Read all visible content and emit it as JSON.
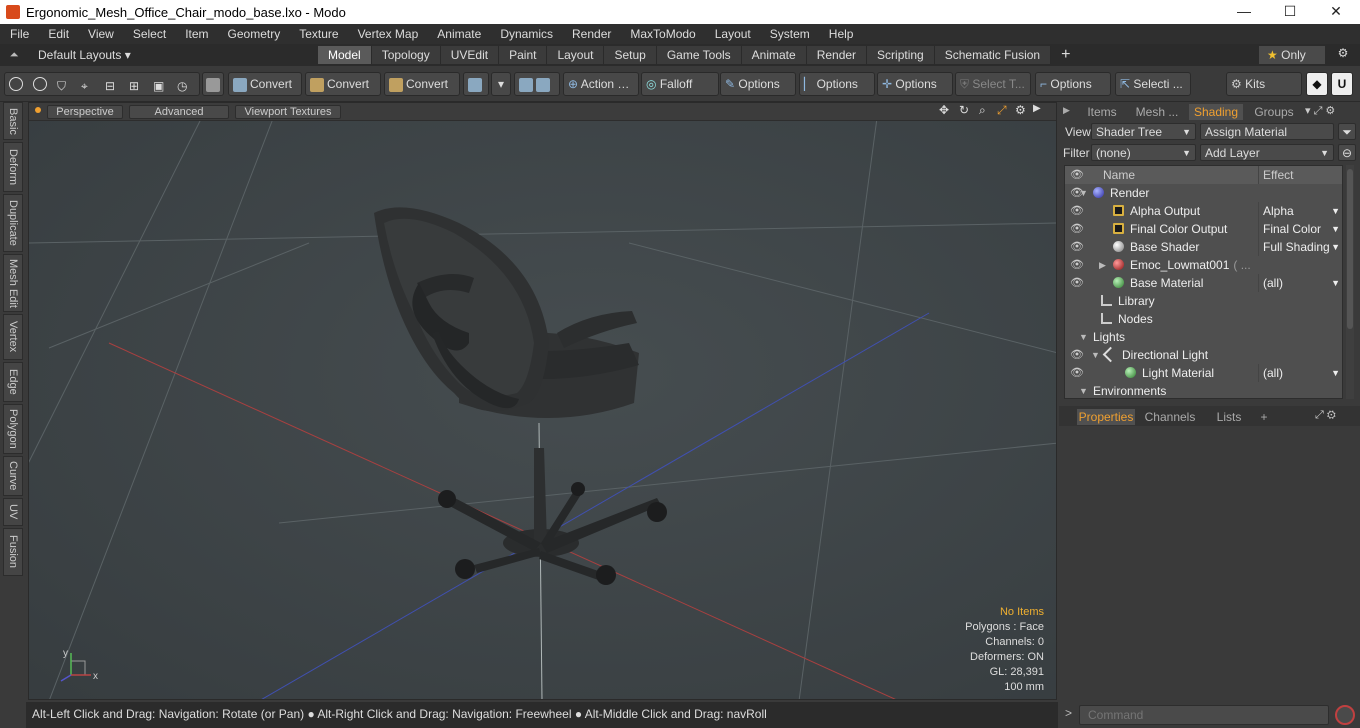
{
  "window": {
    "title": "Ergonomic_Mesh_Office_Chair_modo_base.lxo - Modo",
    "minimize": "—",
    "maximize": "☐",
    "close": "✕"
  },
  "menu": [
    "File",
    "Edit",
    "View",
    "Select",
    "Item",
    "Geometry",
    "Texture",
    "Vertex Map",
    "Animate",
    "Dynamics",
    "Render",
    "MaxToModo",
    "Layout",
    "System",
    "Help"
  ],
  "layoutbar": {
    "default_layouts": "Default Layouts ▾",
    "tabs": [
      "Model",
      "Topology",
      "UVEdit",
      "Paint",
      "Layout",
      "Setup",
      "Game Tools",
      "Animate",
      "Render",
      "Scripting",
      "Schematic Fusion"
    ],
    "active_tab": "Model",
    "add": "+",
    "only": "Only"
  },
  "toolbar": {
    "convert1": "Convert",
    "convert2": "Convert",
    "convert3": "Convert",
    "action": "Action",
    "falloff": "Falloff",
    "options1": "Options",
    "options2": "Options",
    "options3": "Options",
    "options4": "Options",
    "select_t": "Select T...",
    "selecti": "Selecti ...",
    "kits": "Kits"
  },
  "lefttabs": [
    "Basic",
    "Deform",
    "Duplicate",
    "Mesh Edit",
    "Vertex",
    "Edge",
    "Polygon",
    "Curve",
    "UV",
    "Fusion"
  ],
  "viewport": {
    "perspective": "Perspective",
    "advanced": "Advanced",
    "textures": "Viewport Textures",
    "hud": {
      "no_items": "No Items",
      "polygons": "Polygons : Face",
      "channels": "Channels: 0",
      "deformers": "Deformers: ON",
      "gl": "GL: 28,391",
      "scale": "100 mm"
    },
    "axes": {
      "x": "x",
      "y": "y"
    }
  },
  "status": "Alt-Left Click and Drag: Navigation: Rotate (or Pan) ● Alt-Right Click and Drag: Navigation: Freewheel ● Alt-Middle Click and Drag: navRoll",
  "shader": {
    "tabs": [
      "Items",
      "Mesh ...",
      "Shading",
      "Groups"
    ],
    "active_tab": "Shading",
    "view_label": "View",
    "view_value": "Shader Tree",
    "assign_material": "Assign Material",
    "filter_label": "Filter",
    "filter_value": "(none)",
    "add_layer": "Add Layer",
    "col_name": "Name",
    "col_effect": "Effect",
    "rows": [
      {
        "name": "Render",
        "effect": "",
        "icon": "sphere-blue",
        "eye": true
      },
      {
        "name": "Alpha Output",
        "effect": "Alpha",
        "icon": "output",
        "eye": true
      },
      {
        "name": "Final Color Output",
        "effect": "Final Color",
        "icon": "output",
        "eye": true
      },
      {
        "name": "Base Shader",
        "effect": "Full Shading",
        "icon": "sphere-white",
        "eye": true
      },
      {
        "name": "Emoc_Lowmat001",
        "effect": "",
        "icon": "sphere-red",
        "eye": true,
        "suffix": "( ..."
      },
      {
        "name": "Base Material",
        "effect": "(all)",
        "icon": "sphere-green",
        "eye": true
      },
      {
        "name": "Library",
        "effect": "",
        "icon": "folder",
        "eye": false
      },
      {
        "name": "Nodes",
        "effect": "",
        "icon": "folder",
        "eye": false
      },
      {
        "name": "Lights",
        "effect": "",
        "icon": "none",
        "eye": false
      },
      {
        "name": "Directional Light",
        "effect": "",
        "icon": "light",
        "eye": true
      },
      {
        "name": "Light Material",
        "effect": "(all)",
        "icon": "sphere-green",
        "eye": true
      },
      {
        "name": "Environments",
        "effect": "",
        "icon": "none",
        "eye": false
      }
    ]
  },
  "properties": {
    "tabs": [
      "Properties",
      "Channels",
      "Lists"
    ],
    "active_tab": "Properties",
    "add": "+"
  },
  "command": {
    "placeholder": "Command"
  },
  "colors": {
    "accent": "#f0a030",
    "viewport_bg": "#3e4447",
    "panel": "#3a3a3a"
  }
}
